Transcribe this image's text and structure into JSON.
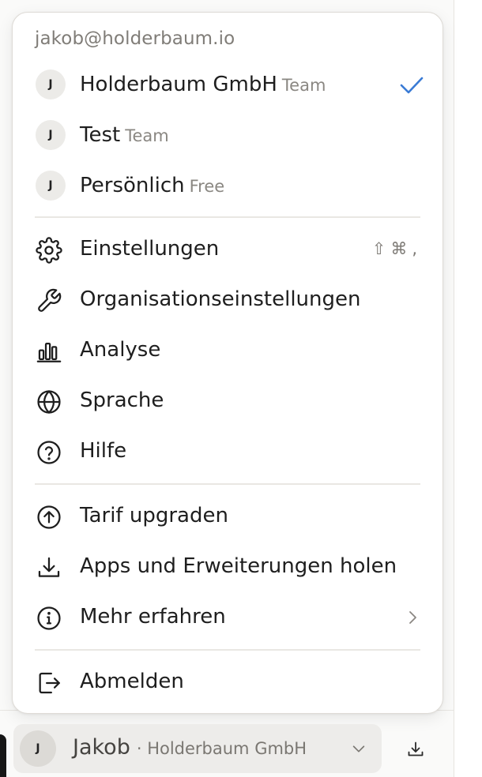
{
  "account": {
    "email": "jakob@holderbaum.io"
  },
  "organizations": [
    {
      "initial": "J",
      "name": "Holderbaum GmbH",
      "plan": "Team",
      "selected": true
    },
    {
      "initial": "J",
      "name": "Test",
      "plan": "Team",
      "selected": false
    },
    {
      "initial": "J",
      "name": "Persönlich",
      "plan": "Free",
      "selected": false
    }
  ],
  "menu": {
    "settings": {
      "label": "Einstellungen",
      "icon": "gear-icon",
      "shortcut": "⇧⌘,"
    },
    "org_settings": {
      "label": "Organisationseinstellungen",
      "icon": "wrench-icon"
    },
    "analytics": {
      "label": "Analyse",
      "icon": "bar-chart-icon"
    },
    "language": {
      "label": "Sprache",
      "icon": "globe-icon"
    },
    "help": {
      "label": "Hilfe",
      "icon": "help-circle-icon"
    },
    "upgrade": {
      "label": "Tarif upgraden",
      "icon": "arrow-up-circle-icon"
    },
    "apps": {
      "label": "Apps und Erweiterungen holen",
      "icon": "download-icon"
    },
    "learn_more": {
      "label": "Mehr erfahren",
      "icon": "info-circle-icon"
    },
    "logout": {
      "label": "Abmelden",
      "icon": "logout-icon"
    }
  },
  "user_bar": {
    "initial": "J",
    "name": "Jakob",
    "org": "· Holderbaum GmbH"
  },
  "colors": {
    "accent": "#3a7bd5",
    "menu_bg": "#ffffff",
    "muted": "#8a8782"
  }
}
